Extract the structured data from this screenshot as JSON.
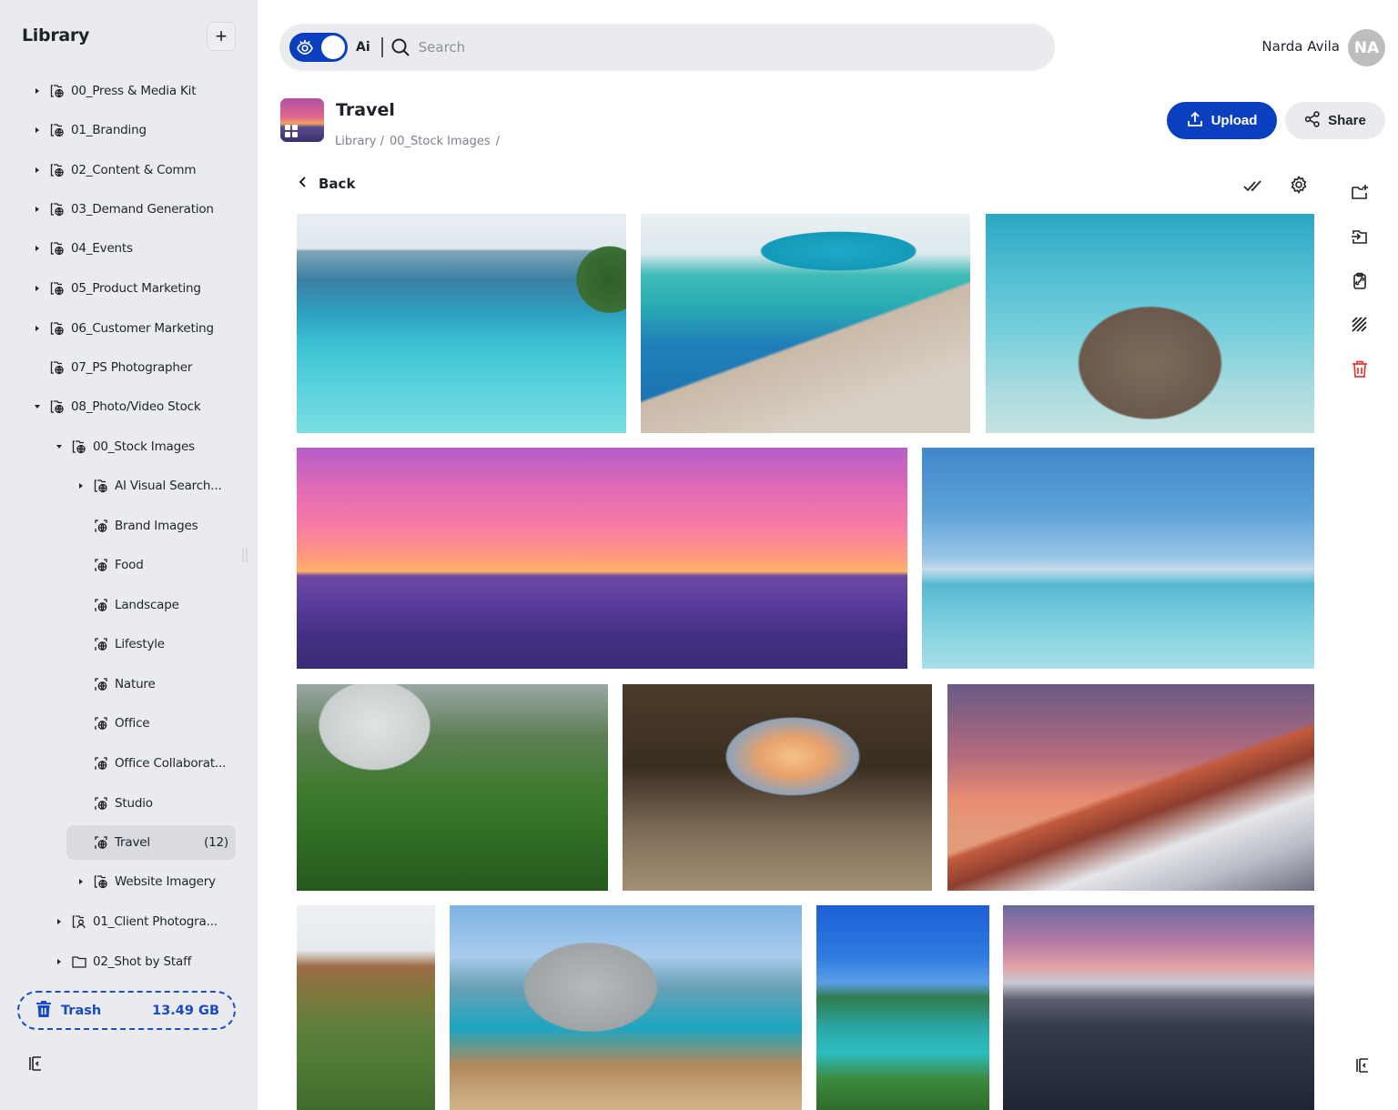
{
  "sidebar": {
    "title": "Library",
    "add_button": "+",
    "tree": [
      {
        "label": "00_Press & Media Kit",
        "caret": "right",
        "icon": "folder-globe-icon"
      },
      {
        "label": "01_Branding",
        "caret": "right",
        "icon": "folder-globe-icon"
      },
      {
        "label": "02_Content & Comm",
        "caret": "right",
        "icon": "folder-globe-icon"
      },
      {
        "label": "03_Demand Generation",
        "caret": "right",
        "icon": "folder-globe-icon"
      },
      {
        "label": "04_Events",
        "caret": "right",
        "icon": "folder-globe-icon"
      },
      {
        "label": "05_Product Marketing",
        "caret": "right",
        "icon": "folder-globe-icon"
      },
      {
        "label": "06_Customer Marketing",
        "caret": "right",
        "icon": "folder-globe-icon"
      },
      {
        "label": "07_PS Photographer",
        "caret": "none",
        "icon": "folder-globe-icon"
      },
      {
        "label": "08_Photo/Video Stock",
        "caret": "down",
        "icon": "folder-globe-icon"
      },
      {
        "label": "00_Stock Images",
        "caret": "down",
        "icon": "folder-globe-icon"
      },
      {
        "label": "AI Visual Search...",
        "caret": "right",
        "icon": "folder-globe-icon"
      },
      {
        "label": "Brand Images",
        "caret": "none",
        "icon": "collection-globe-icon"
      },
      {
        "label": "Food",
        "caret": "none",
        "icon": "collection-globe-icon"
      },
      {
        "label": "Landscape",
        "caret": "none",
        "icon": "collection-globe-icon"
      },
      {
        "label": "Lifestyle",
        "caret": "none",
        "icon": "collection-globe-icon"
      },
      {
        "label": "Nature",
        "caret": "none",
        "icon": "collection-globe-icon"
      },
      {
        "label": "Office",
        "caret": "none",
        "icon": "collection-globe-icon"
      },
      {
        "label": "Office Collaborat...",
        "caret": "none",
        "icon": "collection-globe-icon"
      },
      {
        "label": "Studio",
        "caret": "none",
        "icon": "collection-globe-icon"
      },
      {
        "label": "Travel",
        "caret": "none",
        "icon": "collection-globe-icon",
        "count": "(12)",
        "active": true
      },
      {
        "label": "Website Imagery",
        "caret": "right",
        "icon": "folder-globe-icon"
      },
      {
        "label": "01_Client Photogra...",
        "caret": "right",
        "icon": "folder-user-icon"
      },
      {
        "label": "02_Shot by Staff",
        "caret": "right",
        "icon": "folder-icon"
      }
    ],
    "trash": {
      "label": "Trash",
      "size": "13.49 GB"
    }
  },
  "search": {
    "ai_label": "Ai",
    "ai_enabled": true,
    "placeholder": "Search",
    "value": ""
  },
  "user": {
    "name": "Narda Avila",
    "initials": "NA"
  },
  "header": {
    "title": "Travel",
    "breadcrumb": [
      "Library /",
      "00_Stock Images",
      "/"
    ],
    "upload_label": "Upload",
    "share_label": "Share",
    "back_label": "Back"
  },
  "gallery": {
    "item_count": 12,
    "photos": [
      {
        "subject": "infinity pool couple ocean"
      },
      {
        "subject": "pool umbrella loungers"
      },
      {
        "subject": "woman in hat on wicker float"
      },
      {
        "subject": "sunset pier overwater bungalows"
      },
      {
        "subject": "rooftop infinity pool"
      },
      {
        "subject": "misty mountain winding road"
      },
      {
        "subject": "sea cave sunset"
      },
      {
        "subject": "snowy mountain peaks at sunset"
      },
      {
        "subject": "green hills"
      },
      {
        "subject": "coastal cliff with daisies"
      },
      {
        "subject": "aerial turquoise bay"
      },
      {
        "subject": "mountains over black sand dunes"
      }
    ]
  },
  "colors": {
    "primary": "#0a40c0",
    "danger": "#e53935",
    "sidebar_bg": "#eaebee"
  }
}
